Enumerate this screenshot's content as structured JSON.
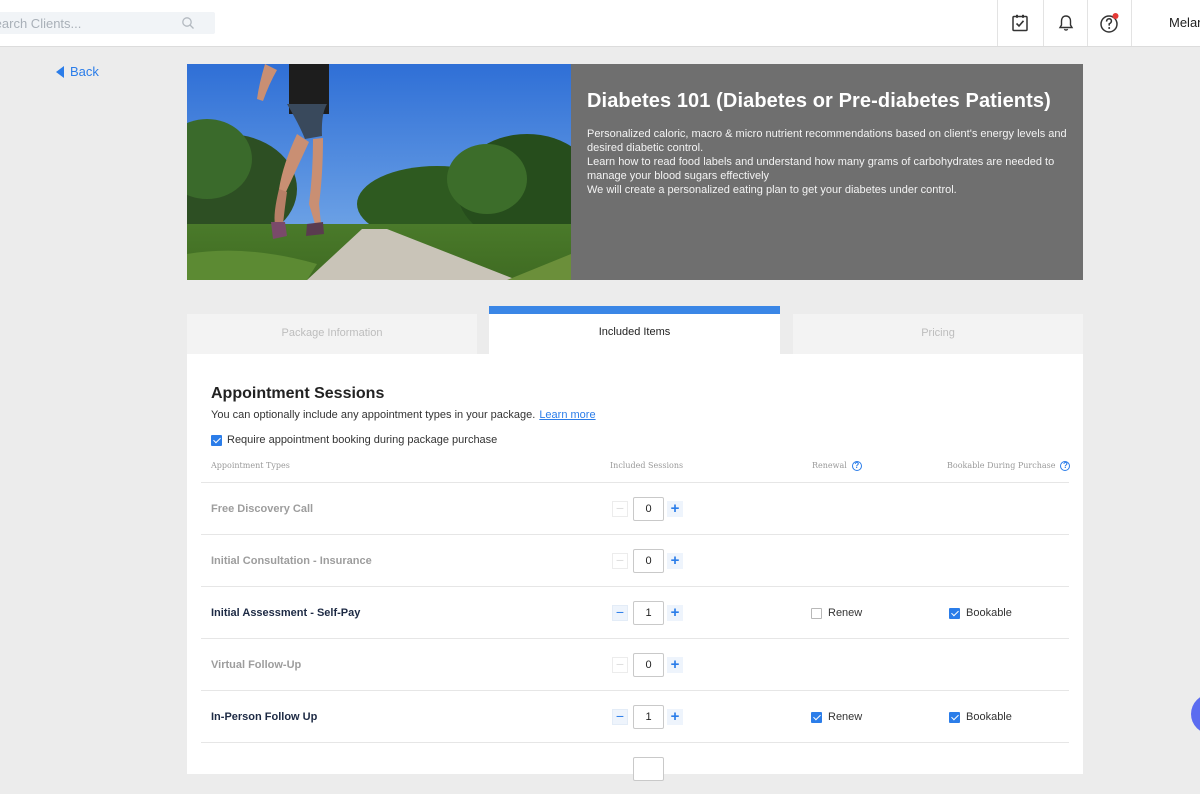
{
  "topbar": {
    "search_placeholder": "Search Clients...",
    "user_name": "Melanie"
  },
  "back_label": "Back",
  "hero": {
    "title": "Diabetes 101 (Diabetes or Pre-diabetes Patients)",
    "lines": [
      "Personalized caloric, macro & micro nutrient recommendations based on client's energy levels and desired diabetic control.",
      "Learn how to read food labels and understand how many grams of carbohydrates are needed to manage your blood sugars effectively",
      "We will create a personalized eating plan to get your diabetes under control."
    ]
  },
  "tabs": [
    {
      "label": "Package Information",
      "active": false
    },
    {
      "label": "Included Items",
      "active": true
    },
    {
      "label": "Pricing",
      "active": false
    }
  ],
  "section": {
    "title": "Appointment Sessions",
    "description": "You can optionally include any appointment types in your package.",
    "learn_more": "Learn more",
    "require_label": "Require appointment booking during package purchase",
    "require_checked": true
  },
  "table": {
    "headers": {
      "types": "Appointment Types",
      "sessions": "Included Sessions",
      "renewal": "Renewal",
      "bookable": "Bookable During Purchase"
    },
    "rows": [
      {
        "name": "Free Discovery Call",
        "sessions": "0"
      },
      {
        "name": "Initial Consultation - Insurance",
        "sessions": "0"
      },
      {
        "name": "Initial Assessment - Self-Pay",
        "sessions": "1",
        "renew_label": "Renew",
        "renew_checked": false,
        "bookable_label": "Bookable",
        "bookable_checked": true
      },
      {
        "name": "Virtual Follow-Up",
        "sessions": "0"
      },
      {
        "name": "In-Person Follow Up",
        "sessions": "1",
        "renew_label": "Renew",
        "renew_checked": true,
        "bookable_label": "Bookable",
        "bookable_checked": true
      }
    ]
  },
  "colors": {
    "accent": "#2b7de9",
    "hero_bg": "#6f6f6f",
    "tab_active_border": "#3a86e6"
  }
}
